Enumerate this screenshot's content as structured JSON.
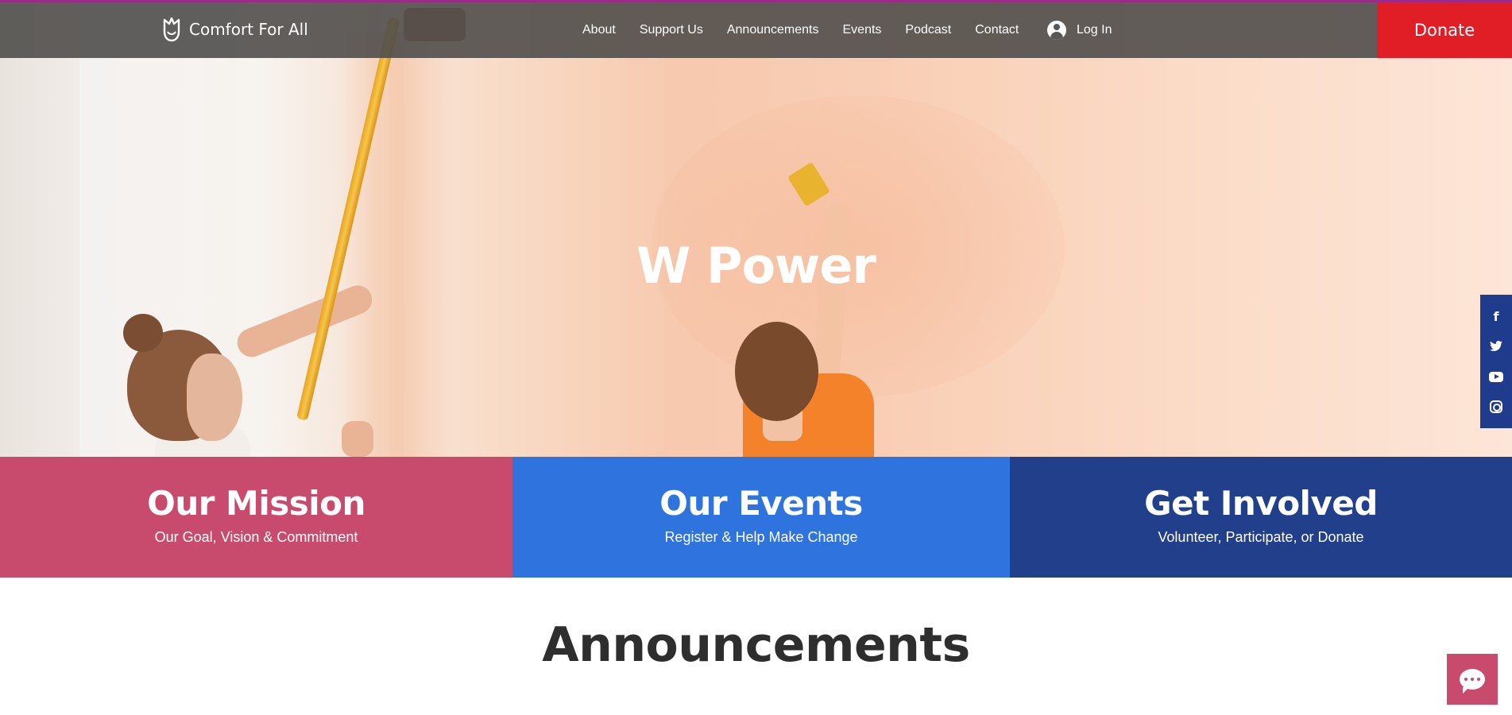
{
  "header": {
    "brand": "Comfort For All",
    "nav": [
      "About",
      "Support Us",
      "Announcements",
      "Events",
      "Podcast",
      "Contact"
    ],
    "login_label": "Log In",
    "donate_label": "Donate"
  },
  "hero": {
    "title": "W Power"
  },
  "social": {
    "icons": [
      "facebook-icon",
      "twitter-icon",
      "youtube-icon",
      "instagram-icon"
    ]
  },
  "tiles": [
    {
      "title": "Our Mission",
      "subtitle": "Our Goal, Vision & Commitment",
      "color": "#c84a6c"
    },
    {
      "title": "Our Events",
      "subtitle": "Register & Help Make Change",
      "color": "#2e73de"
    },
    {
      "title": "Get Involved",
      "subtitle": "Volunteer, Participate, or Donate",
      "color": "#213f8b"
    }
  ],
  "announcements": {
    "title": "Announcements"
  },
  "colors": {
    "accent_red": "#e11e26",
    "header_bg": "#504e4b",
    "top_line": "#9b2b8a",
    "social_bg": "#1f3c8c"
  }
}
